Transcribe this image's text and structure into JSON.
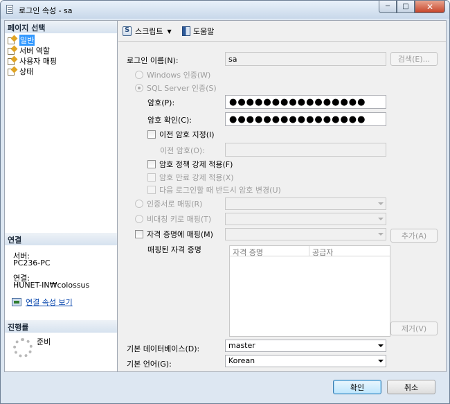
{
  "window": {
    "title": "로그인 속성 - sa",
    "minimize": "─",
    "maximize": "□",
    "close": "✕"
  },
  "left_panel": {
    "pages_header": "페이지 선택",
    "pages": [
      {
        "label": "일반",
        "selected": true
      },
      {
        "label": "서버 역할",
        "selected": false
      },
      {
        "label": "사용자 매핑",
        "selected": false
      },
      {
        "label": "상태",
        "selected": false
      }
    ],
    "connection_header": "연결",
    "server_label": "서버:",
    "server_value": "PC236-PC",
    "connection_label": "연결:",
    "connection_value": "HUNET-IN₩colossus",
    "view_connection_link": "연결 속성 보기",
    "progress_header": "진행률",
    "progress_status": "준비"
  },
  "toolbar": {
    "script_label": "스크립트",
    "help_label": "도움말"
  },
  "form": {
    "login_name_label": "로그인 이름(N):",
    "login_name_value": "sa",
    "search_button": "검색(E)...",
    "windows_auth_label": "Windows 인증(W)",
    "sql_auth_label": "SQL Server 인증(S)",
    "password_label": "암호(P):",
    "password_value": "●●●●●●●●●●●●●●●●",
    "confirm_password_label": "암호 확인(C):",
    "confirm_password_value": "●●●●●●●●●●●●●●●●",
    "specify_old_password_label": "이전 암호 지정(I)",
    "old_password_label": "이전 암호(O):",
    "old_password_value": "",
    "enforce_policy_label": "암호 정책 강제 적용(F)",
    "enforce_expiration_label": "암호 만료 강제 적용(X)",
    "must_change_label": "다음 로그인할 때 반드시 암호 변경(U)",
    "cert_mapping_label": "인증서로 매핑(R)",
    "asym_key_mapping_label": "비대칭 키로 매핑(T)",
    "credential_mapping_label": "자격 증명에 매핑(M)",
    "add_button": "추가(A)",
    "mapped_credentials_label": "매핑된 자격 증명",
    "credential_columns": [
      "자격 증명",
      "공급자"
    ],
    "remove_button": "제거(V)",
    "default_database_label": "기본 데이터베이스(D):",
    "default_database_value": "master",
    "default_language_label": "기본 언어(G):",
    "default_language_value": "Korean"
  },
  "footer": {
    "ok_button": "확인",
    "cancel_button": "취소"
  }
}
